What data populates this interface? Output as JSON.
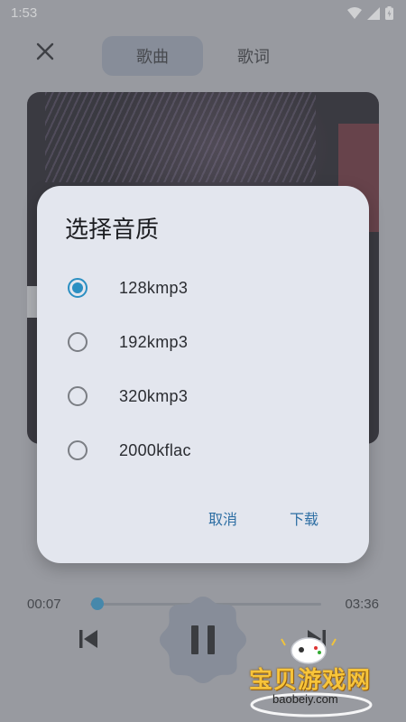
{
  "status": {
    "time": "1:53"
  },
  "header": {
    "tabs": [
      {
        "label": "歌曲",
        "active": true
      },
      {
        "label": "歌词",
        "active": false
      }
    ]
  },
  "dialog": {
    "title": "选择音质",
    "options": [
      {
        "label": "128kmp3",
        "selected": true
      },
      {
        "label": "192kmp3",
        "selected": false
      },
      {
        "label": "320kmp3",
        "selected": false
      },
      {
        "label": "2000kflac",
        "selected": false
      }
    ],
    "cancel_label": "取消",
    "download_label": "下载"
  },
  "player": {
    "current_time": "00:07",
    "total_time": "03:36",
    "progress": 0.03
  },
  "watermark": {
    "text": "宝贝游戏网",
    "url": "baobeiy.com"
  },
  "colors": {
    "accent": "#2b8fc2",
    "dialog_bg": "#e3e6ee",
    "button_text": "#2d6ea3"
  }
}
